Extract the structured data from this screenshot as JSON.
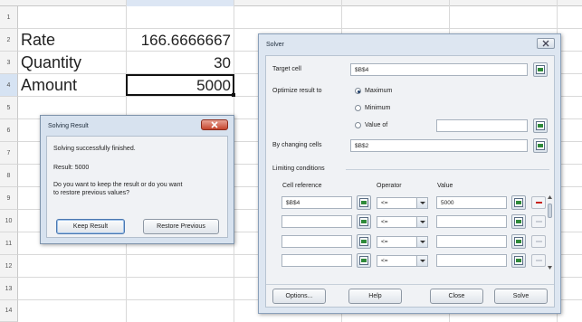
{
  "sheet": {
    "row_numbers": [
      "1",
      "2",
      "3",
      "4",
      "5",
      "6",
      "7",
      "8",
      "9",
      "10",
      "11",
      "12",
      "13",
      "14"
    ],
    "cells": {
      "A2": "Rate",
      "B2": "166.6666667",
      "A3": "Quantity",
      "B3": "30",
      "A4": "Amount",
      "B4": "5000"
    }
  },
  "result_dialog": {
    "title": "Solving Result",
    "message1": "Solving successfully finished.",
    "message2": "Result: 5000",
    "message3_line1": "Do you want to keep the result or do you want",
    "message3_line2": "to restore previous values?",
    "keep_button": "Keep Result",
    "restore_button": "Restore Previous"
  },
  "solver": {
    "title": "Solver",
    "target_cell_label": "Target cell",
    "target_cell_value": "$B$4",
    "optimize_label": "Optimize result to",
    "opt_maximum": "Maximum",
    "opt_minimum": "Minimum",
    "opt_value_of": "Value of",
    "value_of_input": "",
    "changing_cells_label": "By changing cells",
    "changing_cells_value": "$B$2",
    "limiting_conditions_label": "Limiting conditions",
    "col_cell_reference": "Cell reference",
    "col_operator": "Operator",
    "col_value": "Value",
    "conditions": [
      {
        "ref": "$B$4",
        "op": "<=",
        "value": "5000"
      },
      {
        "ref": "",
        "op": "<=",
        "value": ""
      },
      {
        "ref": "",
        "op": "<=",
        "value": ""
      },
      {
        "ref": "",
        "op": "<=",
        "value": ""
      }
    ],
    "buttons": {
      "options": "Options...",
      "help": "Help",
      "close": "Close",
      "solve": "Solve"
    },
    "colors": {
      "accent": "#1f6b2a",
      "delete_active": "#c8221b"
    }
  }
}
